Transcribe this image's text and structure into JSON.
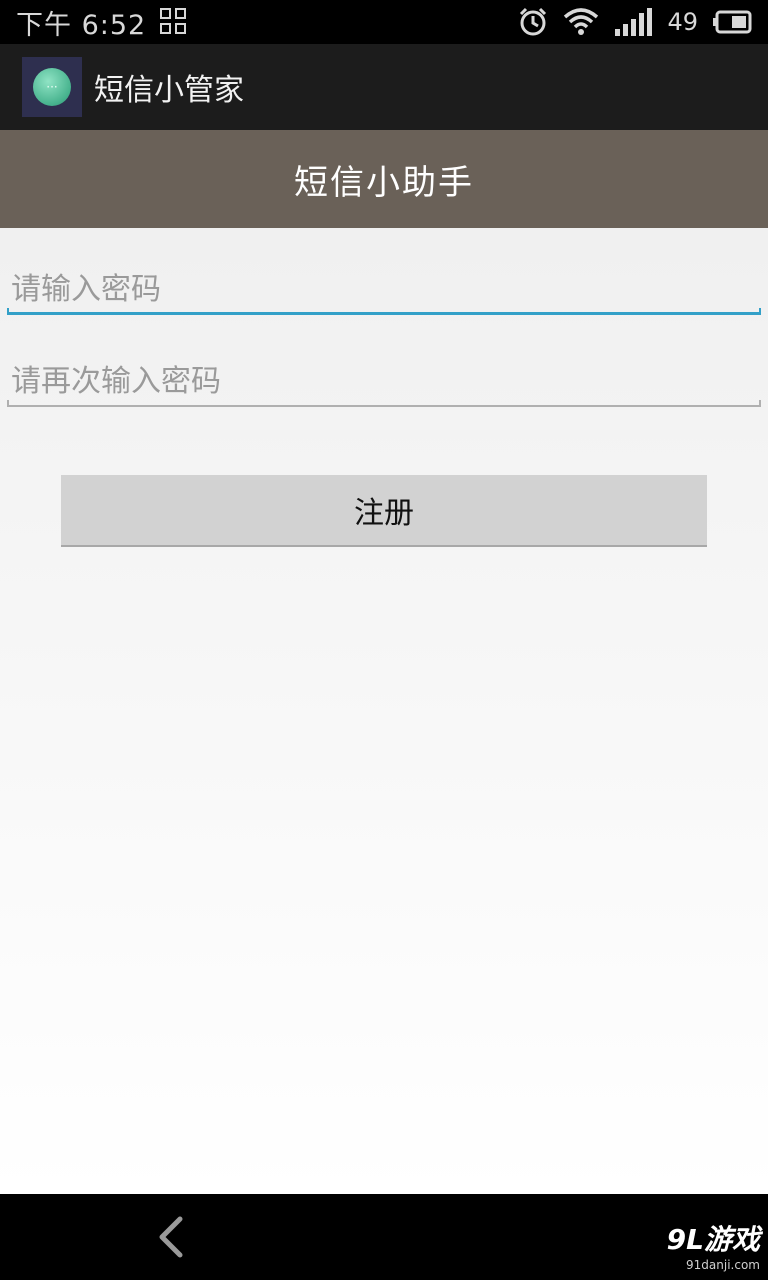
{
  "status_bar": {
    "time": "下午 6:52",
    "battery_level": "49"
  },
  "action_bar": {
    "app_title": "短信小管家"
  },
  "header": {
    "title": "短信小助手"
  },
  "form": {
    "password_placeholder": "请输入密码",
    "confirm_password_placeholder": "请再次输入密码",
    "register_label": "注册"
  },
  "watermark": {
    "logo": "9L游戏",
    "url": "91danji.com"
  },
  "colors": {
    "header_band": "#6a6158",
    "focus_accent": "#33a0c8",
    "button_bg": "#d2d2d2"
  }
}
